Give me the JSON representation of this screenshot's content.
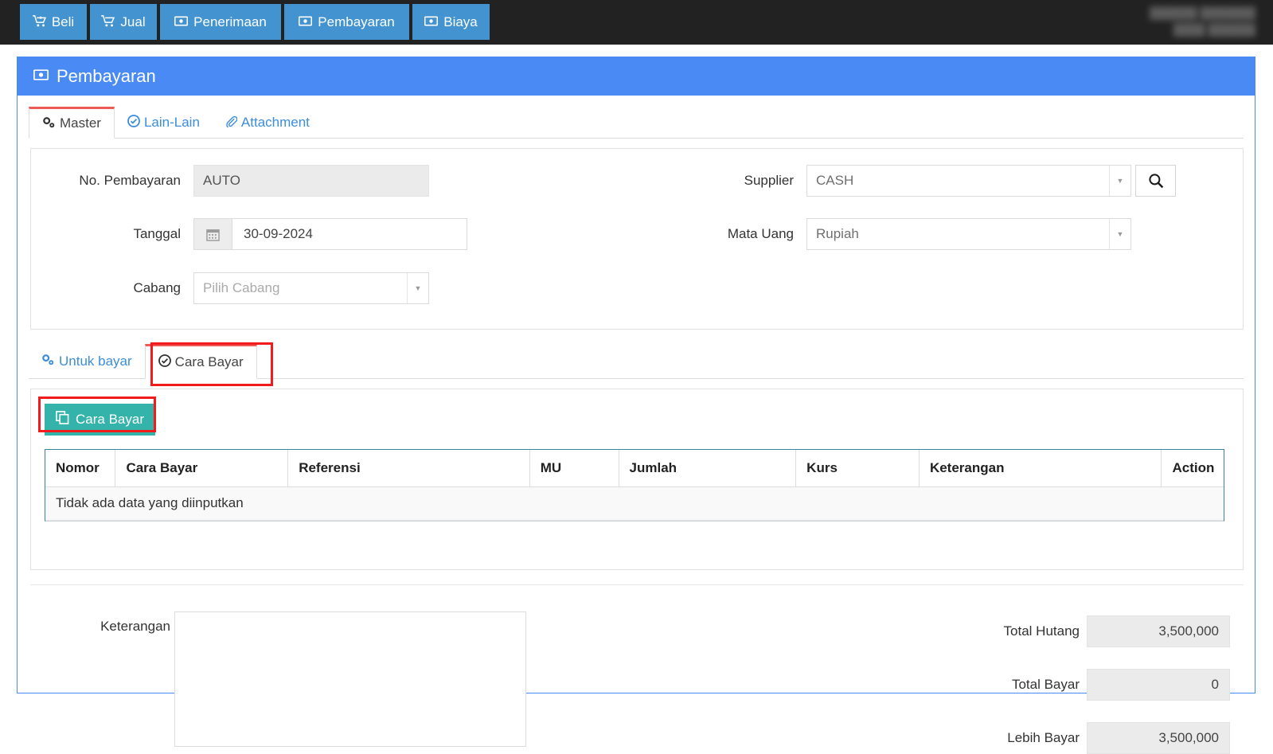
{
  "topnav": {
    "buttons": [
      {
        "label": "Beli",
        "icon": "shopping-cart-plus-icon",
        "glyph": "🛒"
      },
      {
        "label": "Jual",
        "icon": "shopping-cart-icon",
        "glyph": "🛒"
      },
      {
        "label": "Penerimaan",
        "icon": "money-bill-icon",
        "glyph": "💵"
      },
      {
        "label": "Pembayaran",
        "icon": "money-bill-icon",
        "glyph": "💵"
      },
      {
        "label": "Biaya",
        "icon": "money-bill-icon",
        "glyph": "💵"
      }
    ],
    "user_line1": "██████ ███████",
    "user_line2": "████ ██████"
  },
  "panel": {
    "title": "Pembayaran",
    "title_icon": "money-bill-icon"
  },
  "main_tabs": [
    {
      "label": "Master",
      "icon": "gears-icon",
      "active": true
    },
    {
      "label": "Lain-Lain",
      "icon": "check-circle-icon",
      "active": false
    },
    {
      "label": "Attachment",
      "icon": "paperclip-icon",
      "active": false
    }
  ],
  "form": {
    "no_pembayaran": {
      "label": "No. Pembayaran",
      "value": "AUTO",
      "readonly": true
    },
    "tanggal": {
      "label": "Tanggal",
      "value": "30-09-2024",
      "icon": "calendar-icon"
    },
    "cabang": {
      "label": "Cabang",
      "placeholder": "Pilih Cabang",
      "value": ""
    },
    "supplier": {
      "label": "Supplier",
      "value": "CASH",
      "search_icon": "search-icon"
    },
    "mata_uang": {
      "label": "Mata Uang",
      "value": "Rupiah"
    }
  },
  "sub_tabs": [
    {
      "label": "Untuk bayar",
      "icon": "gears-icon",
      "active": false
    },
    {
      "label": "Cara Bayar",
      "icon": "check-circle-icon",
      "active": true
    }
  ],
  "grid": {
    "add_button": {
      "label": "Cara Bayar",
      "icon": "copy-icon"
    },
    "columns": [
      "Nomor",
      "Cara Bayar",
      "Referensi",
      "MU",
      "Jumlah",
      "Kurs",
      "Keterangan",
      "Action"
    ],
    "empty_message": "Tidak ada data yang diinputkan",
    "rows": []
  },
  "bottom": {
    "keterangan": {
      "label": "Keterangan",
      "value": ""
    },
    "totals": [
      {
        "label": "Total Hutang",
        "value": "3,500,000"
      },
      {
        "label": "Total Bayar",
        "value": "0"
      },
      {
        "label": "Lebih Bayar",
        "value": "3,500,000"
      }
    ]
  },
  "colors": {
    "nav_bg": "#222222",
    "nav_button": "#4293cf",
    "panel_header": "#4a8af4",
    "accent_teal": "#34b3ab",
    "tab_active_top": "#ec5b56",
    "highlight_box": "#f21b1b",
    "link_blue": "#3c8dde"
  }
}
